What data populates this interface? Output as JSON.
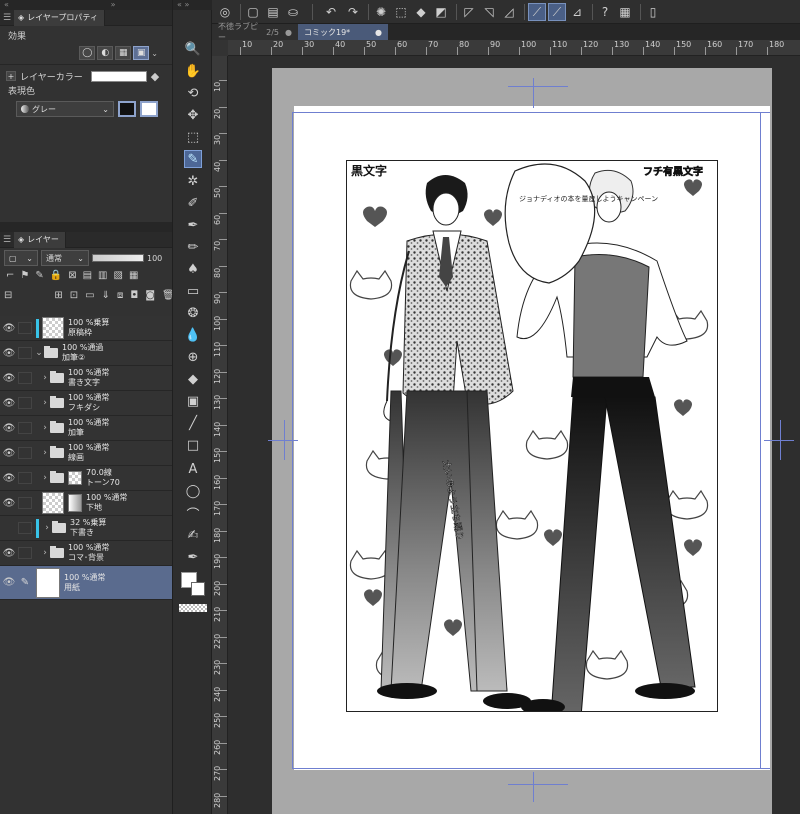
{
  "colors": {
    "accent": "#5d6f94",
    "layer_marker": "#38c3e8",
    "guide": "#6f7fd0"
  },
  "props_panel": {
    "tab_label": "レイヤープロパティ",
    "effect_label": "効果",
    "layer_color_label": "レイヤーカラー",
    "expression_color_label": "表現色",
    "expression_color_value": "グレー"
  },
  "layer_panel": {
    "tab_label": "レイヤー",
    "blend_mode": "通常",
    "opacity": "100"
  },
  "layers": [
    {
      "line1": "100 %乗算",
      "line2": "原稿枠"
    },
    {
      "line1": "100 %通過",
      "line2": "加筆②"
    },
    {
      "line1": "100 %通常",
      "line2": "書き文字"
    },
    {
      "line1": "100 %通常",
      "line2": "フキダシ"
    },
    {
      "line1": "100 %通常",
      "line2": "加筆"
    },
    {
      "line1": "100 %通常",
      "line2": "線画"
    },
    {
      "line1": "70.0線",
      "line2": "トーン70"
    },
    {
      "line1": "100 %通常",
      "line2": "下地"
    },
    {
      "line1": "32 %乗算",
      "line2": "下書き"
    },
    {
      "line1": "100 %通常",
      "line2": "コマ･背景"
    },
    {
      "line1": "100 %通常",
      "line2": "用紙"
    }
  ],
  "doc_tabs": [
    {
      "label": "不徳ラブピー",
      "pages": "2/5"
    },
    {
      "label": "コミック19*"
    }
  ],
  "ruler_h": [
    "10",
    "20",
    "30",
    "40",
    "50",
    "60",
    "70",
    "80",
    "90",
    "100",
    "110",
    "120",
    "130",
    "140",
    "150",
    "160",
    "170",
    "180"
  ],
  "ruler_v": [
    "10",
    "20",
    "30",
    "40",
    "50",
    "60",
    "70",
    "80",
    "90",
    "100",
    "110",
    "120",
    "130",
    "140",
    "150",
    "160",
    "170",
    "180",
    "190",
    "200",
    "210",
    "220",
    "230",
    "240",
    "250",
    "260",
    "270",
    "280"
  ],
  "artwork": {
    "speech_bubble": "ジョナディオの本を量産しようキャンペーン",
    "sfx_text": "フチ有黒文字",
    "black_text": "黒文字",
    "vertical_text": "太いのよう立ち踊り"
  }
}
